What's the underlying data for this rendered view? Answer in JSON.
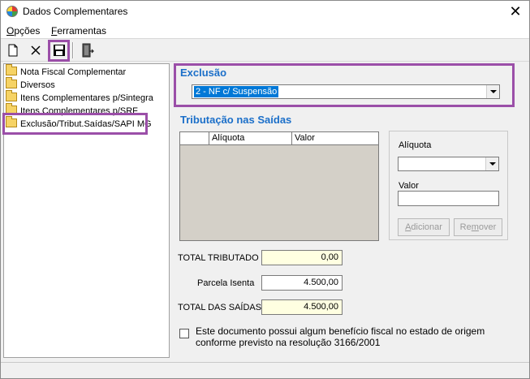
{
  "window": {
    "title": "Dados Complementares"
  },
  "menu": [
    {
      "underline": "O",
      "rest": "pções"
    },
    {
      "underline": "F",
      "rest": "erramentas"
    }
  ],
  "tree": {
    "items": [
      "Nota Fiscal Complementar",
      "Diversos",
      "Itens Complementares p/Sintegra",
      "Itens Complementares p/SRF",
      "Exclusão/Tribut.Saídas/SAPI MG"
    ]
  },
  "exclusao": {
    "title": "Exclusão",
    "selected": "2 - NF c/ Suspensão"
  },
  "tributacao": {
    "title": "Tributação nas Saídas",
    "columns": [
      "Alíquota",
      "Valor"
    ],
    "aliquota_label": "Alíquota",
    "valor_label": "Valor",
    "adicionar": {
      "underline": "A",
      "rest": "dicionar"
    },
    "remover": {
      "pre": "Re",
      "underline": "m",
      "rest": "over"
    }
  },
  "totais": {
    "total_tributado_label": "TOTAL TRIBUTADO",
    "total_tributado_value": "0,00",
    "parcela_isenta_label": "Parcela Isenta",
    "parcela_isenta_value": "4.500,00",
    "total_saidas_label": "TOTAL DAS SAÍDAS",
    "total_saidas_value": "4.500,00"
  },
  "beneficio": {
    "line1": "Este documento possui algum benefício fiscal no  estado  de  origem",
    "line2": "conforme previsto na resolução 3166/2001"
  },
  "colors": {
    "accent": "#1b6fc9",
    "highlight": "#9b4fa8",
    "selection": "#0078d7",
    "readonly_yellow": "#ffffe1"
  }
}
